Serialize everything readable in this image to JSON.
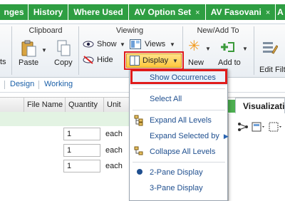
{
  "tabs": [
    {
      "label": "nges",
      "closable": false
    },
    {
      "label": "History",
      "closable": false
    },
    {
      "label": "Where Used",
      "closable": false
    },
    {
      "label": "AV Option Set",
      "closable": true
    },
    {
      "label": "AV Fasovani",
      "closable": true
    },
    {
      "label": "A",
      "closable": false
    }
  ],
  "tab_close_glyph": "×",
  "ribbon": {
    "clipboard": {
      "title": "Clipboard",
      "paste": "Paste",
      "copy": "Copy"
    },
    "viewing": {
      "title": "Viewing",
      "show": "Show",
      "hide": "Hide",
      "views": "Views",
      "display": "Display"
    },
    "newadd": {
      "title": "New/Add To",
      "new": "New",
      "add_to": "Add to"
    },
    "edit": {
      "label": "Edit Filte"
    },
    "left_stub": "ts"
  },
  "subbar": {
    "design": "Design",
    "working": "Working"
  },
  "grid": {
    "columns": [
      "File Name",
      "Quantity",
      "Unit"
    ],
    "rows": [
      {
        "quantity": "1",
        "unit": "each"
      },
      {
        "quantity": "1",
        "unit": "each"
      },
      {
        "quantity": "1",
        "unit": "each"
      }
    ]
  },
  "visualization": {
    "tab": "Visualizatio"
  },
  "display_menu": {
    "items": [
      {
        "label": "Show Occurrences",
        "highlighted": true
      },
      {
        "label": "Select All"
      },
      {
        "label": "Expand All Levels"
      },
      {
        "label": "Expand Selected by"
      },
      {
        "label": "Collapse All Levels"
      },
      {
        "label": "2-Pane Display",
        "selected": true
      },
      {
        "label": "3-Pane Display"
      }
    ]
  },
  "colors": {
    "tab_green": "#2e9e42",
    "highlight_red": "#e01b1b",
    "link_blue": "#1a5fa8"
  }
}
